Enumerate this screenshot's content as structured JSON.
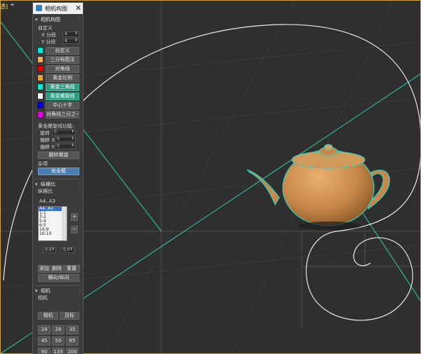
{
  "viewport": {
    "label": "透]",
    "filter_icon": "filter-icon",
    "colors": {
      "background": "#2f2f2f",
      "guide": "#2fb49a",
      "spiral": "#e8e8e8",
      "border": "#c8a040"
    }
  },
  "panel": {
    "title": "相机构图",
    "composition": {
      "header": "相机构图",
      "custom_label": "自定义",
      "x_label": "X 分段",
      "x_value": "4",
      "y_label": "Y 分段",
      "y_value": "4",
      "guides": [
        {
          "label": "自定义",
          "color": "#00e5d0",
          "active": false
        },
        {
          "label": "三分构图法",
          "color": "#e8b060",
          "active": false
        },
        {
          "label": "对角线",
          "color": "#e00000",
          "active": false
        },
        {
          "label": "黄金比例",
          "color": "#e8a040",
          "active": false
        },
        {
          "label": "黄金三角线",
          "color": "#10e8d0",
          "active": true
        },
        {
          "label": "黄金螺旋线",
          "color": "#ffffff",
          "active": true
        },
        {
          "label": "中心十字",
          "color": "#0000d0",
          "active": false
        },
        {
          "label": "对角线三分之一",
          "color": "#e000e0",
          "active": false
        }
      ],
      "spiral_header": "黄金螺旋线功能:",
      "rotate_label": "旋转",
      "rotate_value": "0",
      "offset_x_label": "偏移 X",
      "offset_x_value": "0",
      "offset_y_label": "偏移 Y",
      "offset_y_value": "0",
      "flip_button": "翻转螺旋",
      "misc_label": "杂项",
      "safe_frame_button": "安全框"
    },
    "aspect": {
      "header": "纵横比",
      "label": "纵横比",
      "current": "A4, A3",
      "items": [
        "A4, A3",
        "1:1",
        "3:2",
        "5:4",
        "6:5",
        "16:9",
        "16:10"
      ],
      "plus": "+",
      "minus": "−",
      "w_value": "0.0",
      "h_value": "0.0",
      "add_button": "添加",
      "delete_button": "删除",
      "reset_button": "重置",
      "orient_button": "横向/纵向"
    },
    "camera": {
      "header": "相机",
      "label": "相机",
      "camera_button": "相机",
      "target_button": "目标",
      "focal_lengths": [
        "24",
        "28",
        "35",
        "45",
        "50",
        "85",
        "90",
        "135",
        "200"
      ]
    }
  }
}
